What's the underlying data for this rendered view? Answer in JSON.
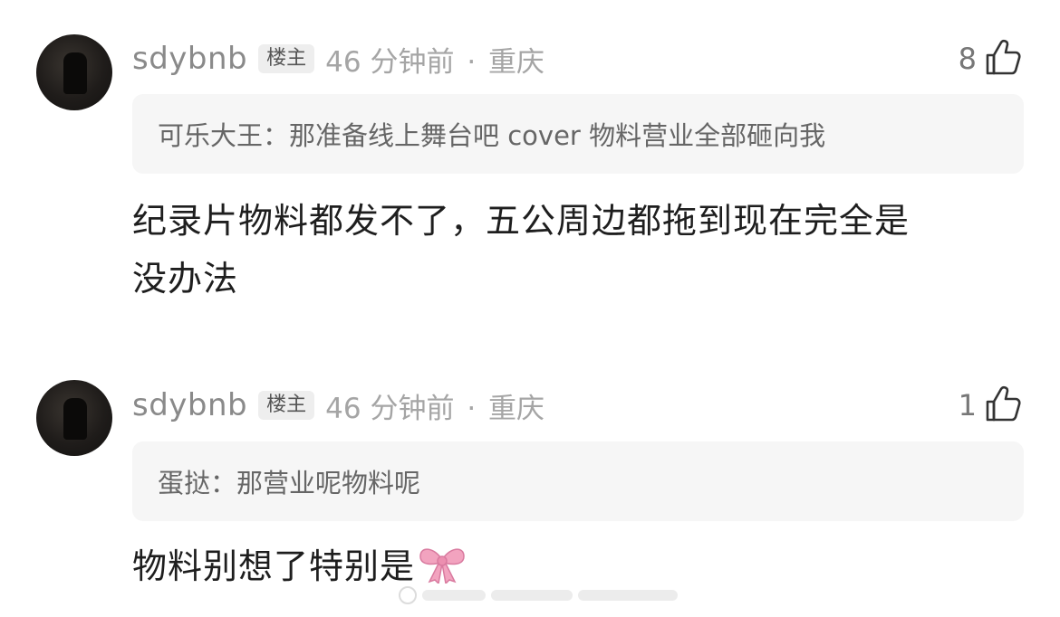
{
  "comments": [
    {
      "username": "sdybnb",
      "badge": "楼主",
      "time": "46 分钟前",
      "separator": "·",
      "location": "重庆",
      "likes": "8",
      "quote_author": "可乐大王：",
      "quote_text": "那准备线上舞台吧 cover 物料营业全部砸向我",
      "body_line1": "纪录片物料都发不了，五公周边都拖到现在完全是",
      "body_line2": "没办法"
    },
    {
      "username": "sdybnb",
      "badge": "楼主",
      "time": "46 分钟前",
      "separator": "·",
      "location": "重庆",
      "likes": "1",
      "quote_author": "蛋挞：",
      "quote_text": "那营业呢物料呢",
      "body_line1": "物料别想了特别是",
      "body_emoji": "bow-icon"
    }
  ],
  "colors": {
    "username": "#8a8a8a",
    "meta": "#a5a5a5",
    "quote_bg": "#f6f6f6",
    "body": "#1e1e1e",
    "bow_pink": "#f2a3bf"
  }
}
